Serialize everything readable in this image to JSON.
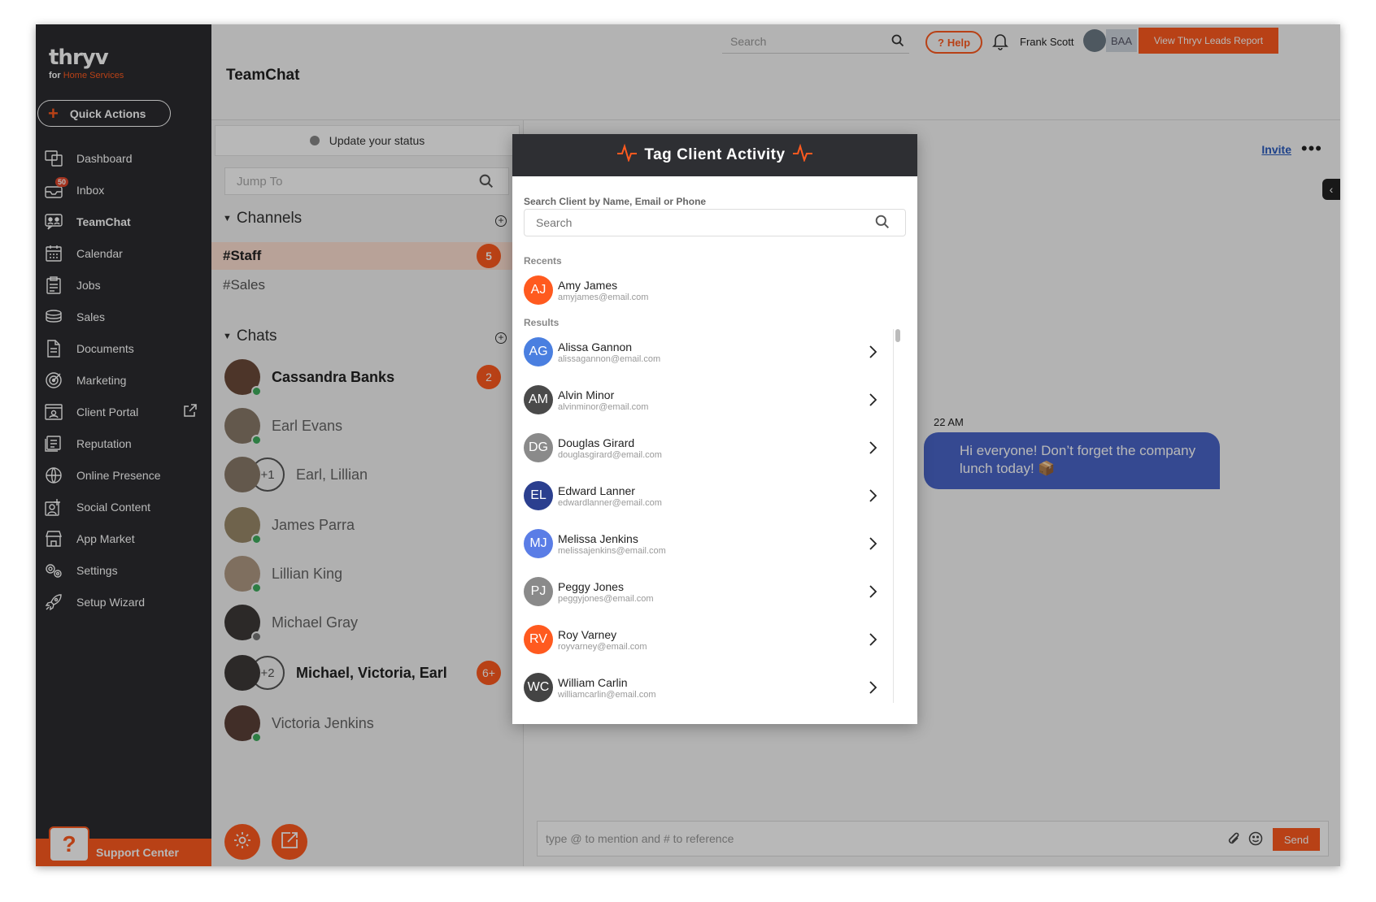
{
  "app": {
    "logo": "thryv",
    "logo_sub_prefix": "for",
    "logo_sub_brand": "Home Services",
    "brand_color": "#ff5a1f"
  },
  "quick_actions": {
    "label": "Quick Actions"
  },
  "nav": {
    "items": [
      {
        "label": "Dashboard",
        "icon": "dashboard-icon"
      },
      {
        "label": "Inbox",
        "icon": "inbox-icon",
        "badge": "50"
      },
      {
        "label": "TeamChat",
        "icon": "teamchat-icon",
        "active": true
      },
      {
        "label": "Calendar",
        "icon": "calendar-icon"
      },
      {
        "label": "Jobs",
        "icon": "jobs-icon"
      },
      {
        "label": "Sales",
        "icon": "sales-icon"
      },
      {
        "label": "Documents",
        "icon": "documents-icon"
      },
      {
        "label": "Marketing",
        "icon": "marketing-icon"
      },
      {
        "label": "Client Portal",
        "icon": "client-portal-icon"
      },
      {
        "label": "Reputation",
        "icon": "reputation-icon"
      },
      {
        "label": "Online Presence",
        "icon": "online-presence-icon"
      },
      {
        "label": "Social Content",
        "icon": "social-content-icon"
      },
      {
        "label": "App Market",
        "icon": "app-market-icon"
      },
      {
        "label": "Settings",
        "icon": "settings-icon"
      },
      {
        "label": "Setup Wizard",
        "icon": "setup-wizard-icon"
      }
    ]
  },
  "support": {
    "label": "Support Center",
    "bubble": "?"
  },
  "header": {
    "title": "TeamChat",
    "search_placeholder": "Search",
    "help_label": "Help",
    "user_name": "Frank Scott",
    "account_badge": "BAA",
    "leads_button": "View Thryv Leads Report"
  },
  "chat_panel": {
    "status_label": "Update your status",
    "jump_placeholder": "Jump To",
    "channels_label": "Channels",
    "channels": [
      {
        "name": "#Staff",
        "count": "5",
        "active": true
      },
      {
        "name": "#Sales"
      }
    ],
    "chats_label": "Chats",
    "chats": [
      {
        "name": "Cassandra Banks",
        "count": "2",
        "bold": true,
        "status": "online"
      },
      {
        "name": "Earl Evans",
        "status": "online"
      },
      {
        "name": "Earl, Lillian",
        "group": "+1"
      },
      {
        "name": "James Parra",
        "status": "online"
      },
      {
        "name": "Lillian King",
        "status": "online"
      },
      {
        "name": "Michael Gray",
        "status": "offline"
      },
      {
        "name": "Michael, Victoria, Earl",
        "group": "+2",
        "count": "6+",
        "bold": true
      },
      {
        "name": "Victoria Jenkins",
        "status": "online"
      }
    ]
  },
  "conversation": {
    "invite_label": "Invite",
    "more_label": "•••",
    "message_time": "22 AM",
    "message_text": "Hi everyone! Don’t forget the company lunch today! 📦",
    "composer_placeholder": "type @ to mention and # to reference",
    "send_label": "Send"
  },
  "modal": {
    "title": "Tag Client Activity",
    "search_label": "Search Client by Name, Email or Phone",
    "search_placeholder": "Search",
    "recents_label": "Recents",
    "results_label": "Results",
    "recents": [
      {
        "initials": "AJ",
        "name": "Amy James",
        "email": "amyjames@email.com",
        "color": "#ff5a1f"
      }
    ],
    "results": [
      {
        "initials": "AG",
        "name": "Alissa Gannon",
        "email": "alissagannon@email.com",
        "color": "#4a7fe0"
      },
      {
        "initials": "AM",
        "name": "Alvin Minor",
        "email": "alvinminor@email.com",
        "color": "#4a4a4a"
      },
      {
        "initials": "DG",
        "name": "Douglas Girard",
        "email": "douglasgirard@email.com",
        "color": "#8a8a8a"
      },
      {
        "initials": "EL",
        "name": "Edward Lanner",
        "email": "edwardlanner@email.com",
        "color": "#2b3f8f"
      },
      {
        "initials": "MJ",
        "name": "Melissa Jenkins",
        "email": "melissajenkins@email.com",
        "color": "#5a7de6"
      },
      {
        "initials": "PJ",
        "name": "Peggy Jones",
        "email": "peggyjones@email.com",
        "color": "#8a8a8a"
      },
      {
        "initials": "RV",
        "name": "Roy Varney",
        "email": "royvarney@email.com",
        "color": "#ff5a1f"
      },
      {
        "initials": "WC",
        "name": "William Carlin",
        "email": "williamcarlin@email.com",
        "color": "#444444"
      }
    ]
  }
}
